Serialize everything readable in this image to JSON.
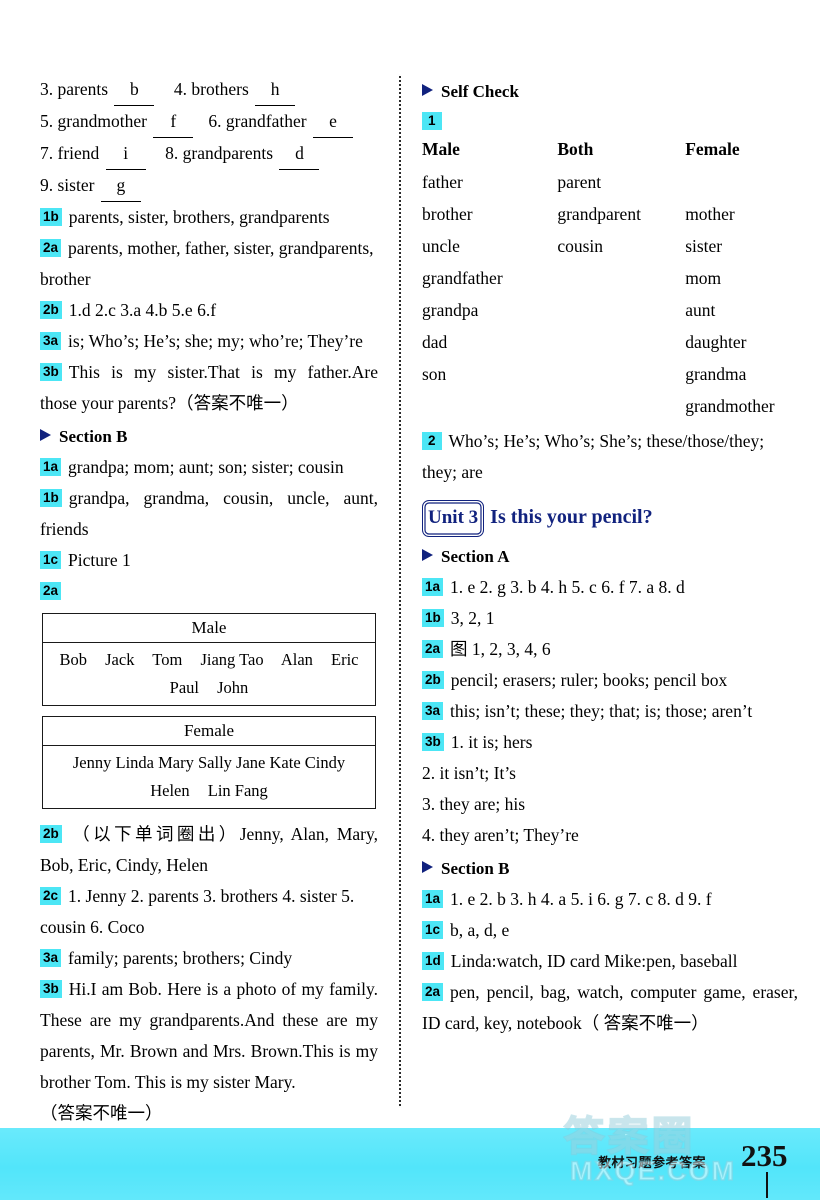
{
  "page": {
    "number": "235",
    "footer_label": "教材习题参考答案",
    "watermark_cn": "答案圈",
    "watermark_en": "MXQE.COM"
  },
  "left_column": {
    "matching_answers": {
      "row1": {
        "n3_label": "3. parents",
        "n3_ans": "b",
        "n4_label": "4. brothers",
        "n4_ans": "h"
      },
      "row2": {
        "n5_label": "5. grandmother",
        "n5_ans": "f",
        "n6_label": "6. grandfather",
        "n6_ans": "e"
      },
      "row3": {
        "n7_label": "7. friend",
        "n7_ans": "i",
        "n8_label": "8. grandparents",
        "n8_ans": "d"
      },
      "row4": {
        "n9_label": "9. sister",
        "n9_ans": "g"
      }
    },
    "items": [
      {
        "badge": "1b",
        "text": "parents, sister, brothers, grandparents"
      },
      {
        "badge": "2a",
        "text": "parents, mother, father, sister, grandparents, brother"
      },
      {
        "badge": "2b",
        "text": "1.d   2.c   3.a   4.b   5.e   6.f"
      },
      {
        "badge": "3a",
        "text": "is; Who’s; He’s; she; my; who’re; They’re"
      },
      {
        "badge": "3b",
        "text": "This is my sister.That is my father.Are those your parents?（答案不唯一）"
      }
    ],
    "section_b_heading": "Section B",
    "section_b_items": [
      {
        "badge": "1a",
        "text": "grandpa; mom; aunt; son; sister; cousin"
      },
      {
        "badge": "1b",
        "text": "grandpa, grandma, cousin, uncle, aunt, friends"
      },
      {
        "badge": "1c",
        "text": "Picture 1"
      },
      {
        "badge": "2a",
        "text": ""
      }
    ],
    "male_table": {
      "header": "Male",
      "row1": [
        "Bob",
        "Jack",
        "Tom",
        "Jiang Tao",
        "Alan",
        "Eric"
      ],
      "row2": [
        "Paul",
        "John"
      ]
    },
    "female_table": {
      "header": "Female",
      "row1": [
        "Jenny",
        "Linda",
        "Mary",
        "Sally",
        "Jane",
        "Kate",
        "Cindy"
      ],
      "row2": [
        "Helen",
        "Lin Fang"
      ]
    },
    "section_b_items2": [
      {
        "badge": "2b",
        "text": "（以下单词圈出）Jenny, Alan, Mary, Bob, Eric, Cindy, Helen"
      },
      {
        "badge": "2c",
        "text": "1. Jenny    2. parents    3. brothers    4. sister    5. cousin    6. Coco"
      },
      {
        "badge": "3a",
        "text": "family; parents; brothers; Cindy"
      },
      {
        "badge": "3b",
        "text": "Hi.I am Bob. Here is a photo of my family. These are my grandparents.And these are my parents, Mr. Brown and Mrs. Brown.This is my brother Tom. This is my sister Mary."
      }
    ],
    "note": "（答案不唯一）"
  },
  "right_column": {
    "self_check_heading": "Self Check",
    "self_check_badge": "1",
    "self_check_table": {
      "headers": [
        "Male",
        "Both",
        "Female"
      ],
      "male": [
        "father",
        "brother",
        "uncle",
        "grandfather",
        "grandpa",
        "dad",
        "son"
      ],
      "both": [
        "parent",
        "grandparent",
        "cousin"
      ],
      "female": [
        "",
        "mother",
        "sister",
        "mom",
        "aunt",
        "daughter",
        "grandma",
        "grandmother"
      ]
    },
    "self_check_item2": {
      "badge": "2",
      "text": "Who’s; He’s; Who’s; She’s; these/those/they; they; are"
    },
    "unit": {
      "tag": "Unit 3",
      "title": "Is this your pencil?"
    },
    "section_a_heading": "Section A",
    "section_a_items": [
      {
        "badge": "1a",
        "text": "1. e   2. g   3. b   4. h   5. c   6. f   7. a   8. d"
      },
      {
        "badge": "1b",
        "text": "3, 2, 1"
      },
      {
        "badge": "2a",
        "text": "图 1, 2, 3, 4, 6"
      },
      {
        "badge": "2b",
        "text": "pencil; erasers; ruler; books; pencil box"
      },
      {
        "badge": "3a",
        "text": "this; isn’t; these; they; that; is; those; aren’t"
      },
      {
        "badge": "3b",
        "text": "1. it is; hers"
      },
      {
        "badge": "",
        "text": "2. it isn’t; It’s"
      },
      {
        "badge": "",
        "text": "3. they are; his"
      },
      {
        "badge": "",
        "text": "4. they aren’t; They’re"
      }
    ],
    "section_b_heading": "Section B",
    "section_b_items": [
      {
        "badge": "1a",
        "text": "1. e   2. b   3. h   4. a   5. i   6. g   7. c   8. d   9. f"
      },
      {
        "badge": "1c",
        "text": "b, a, d, e"
      },
      {
        "badge": "1d",
        "text": "Linda:watch, ID card Mike:pen, baseball"
      },
      {
        "badge": "2a",
        "text": "pen, pencil, bag, watch, computer game, eraser, ID card, key, notebook（ 答案不唯一）"
      }
    ]
  }
}
